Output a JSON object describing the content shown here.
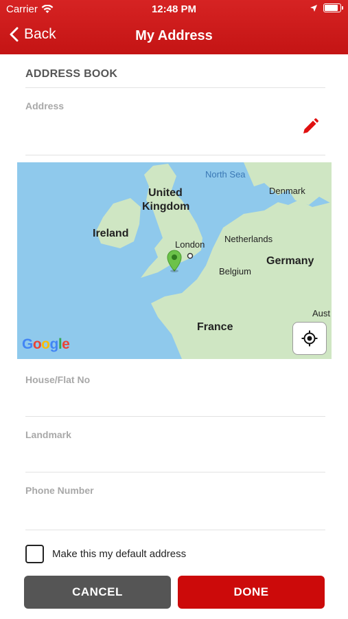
{
  "status_bar": {
    "carrier": "Carrier",
    "time": "12:48 PM",
    "battery_level": 0.95
  },
  "nav": {
    "back_label": "Back",
    "title": "My Address"
  },
  "form": {
    "section_title": "ADDRESS BOOK",
    "address_label": "Address",
    "address_value": "",
    "house_label": "House/Flat No",
    "landmark_label": "Landmark",
    "phone_label": "Phone Number"
  },
  "map": {
    "labels": {
      "north_sea": "North Sea",
      "denmark": "Denmark",
      "united": "United",
      "kingdom": "Kingdom",
      "ireland": "Ireland",
      "london": "London",
      "netherlands": "Netherlands",
      "germany": "Germany",
      "belgium": "Belgium",
      "france": "France",
      "aust": "Aust"
    },
    "logo": [
      "G",
      "o",
      "o",
      "g",
      "l",
      "e"
    ],
    "colors": {
      "water": "#8fc9ec",
      "land": "#cfe6c3",
      "pin": "#6cc24a"
    }
  },
  "default_checkbox": {
    "label": "Make this my default address",
    "checked": false
  },
  "buttons": {
    "cancel": "CANCEL",
    "done": "DONE"
  },
  "colors": {
    "brand_red": "#cc0a0a",
    "cancel_gray": "#555555"
  }
}
